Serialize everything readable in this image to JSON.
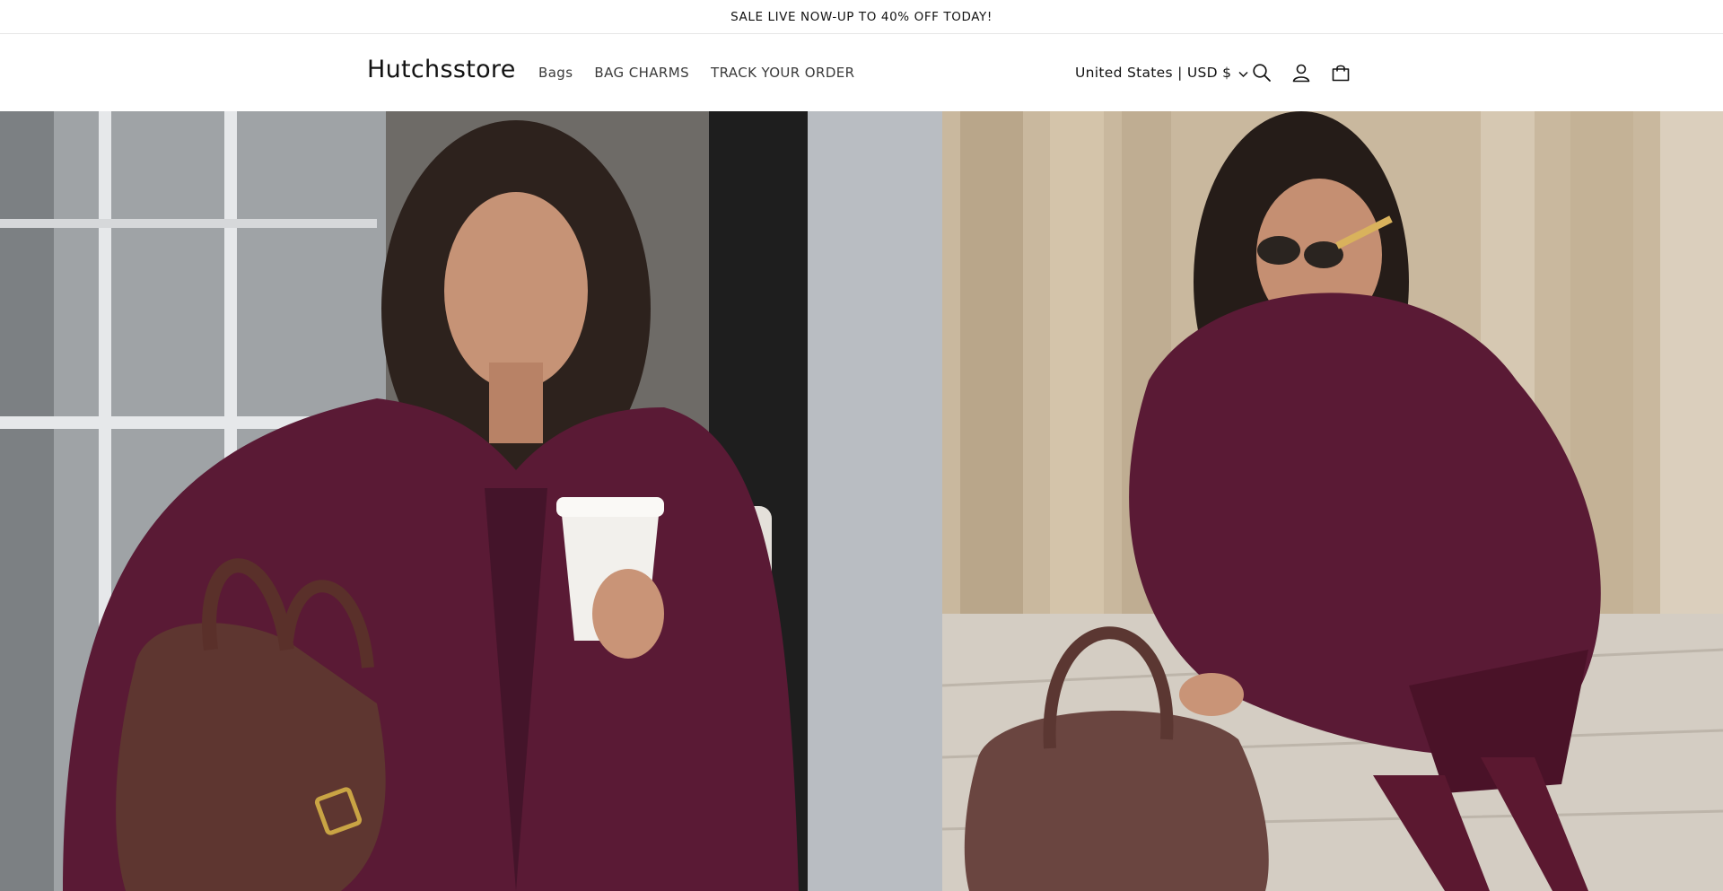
{
  "announcement": {
    "text": "SALE LIVE NOW-UP TO 40% OFF TODAY!"
  },
  "header": {
    "logo": "Hutchsstore",
    "nav": [
      {
        "label": "Bags"
      },
      {
        "label": "BAG CHARMS"
      },
      {
        "label": "TRACK YOUR ORDER"
      }
    ],
    "locale": "United States | USD $",
    "icons": [
      "search-icon",
      "account-icon",
      "cart-icon"
    ]
  },
  "hero": {
    "images": [
      {
        "description_icon": "hero-image-left"
      },
      {
        "description_icon": "hero-image-right"
      }
    ]
  },
  "colors": {
    "text": "#121212",
    "background": "#ffffff",
    "coat": "#5a1a35",
    "bag": "#5e3630"
  }
}
